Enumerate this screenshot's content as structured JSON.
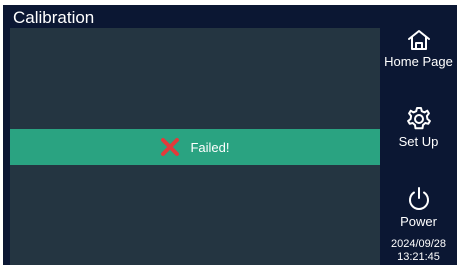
{
  "header": {
    "title": "Calibration"
  },
  "status": {
    "message": "Failed!",
    "icon": "x-mark-icon",
    "color": "#e23b3b"
  },
  "sidebar": {
    "home_label": "Home Page",
    "setup_label": "Set Up",
    "power_label": "Power"
  },
  "clock": {
    "date": "2024/09/28",
    "time": "13:21:45"
  },
  "colors": {
    "frame_bg": "#0b1733",
    "panel_bg": "#243541",
    "banner_bg": "#2aa381"
  }
}
